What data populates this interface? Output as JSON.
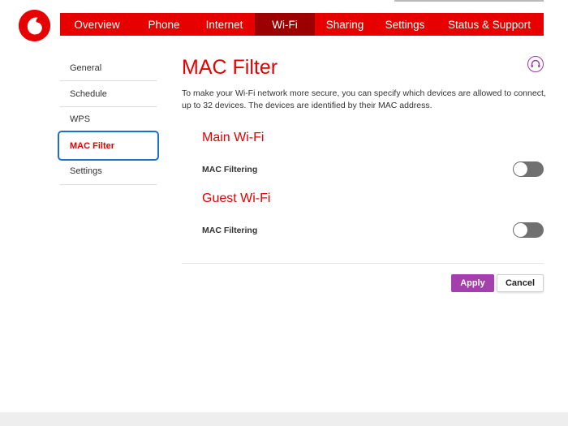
{
  "nav": {
    "tabs": [
      {
        "label": "Overview"
      },
      {
        "label": "Phone"
      },
      {
        "label": "Internet"
      },
      {
        "label": "Wi-Fi"
      },
      {
        "label": "Sharing"
      },
      {
        "label": "Settings"
      },
      {
        "label": "Status & Support"
      }
    ],
    "active": "Wi-Fi"
  },
  "sidebar": {
    "items": [
      {
        "label": "General"
      },
      {
        "label": "Schedule"
      },
      {
        "label": "WPS"
      },
      {
        "label": "MAC Filter"
      },
      {
        "label": "Settings"
      }
    ],
    "active": "MAC Filter"
  },
  "main": {
    "title": "MAC Filter",
    "description": "To make your Wi-Fi network more secure, you can specify which devices are allowed to connect, up to 32 devices. The devices are identified by their MAC address.",
    "sections": [
      {
        "heading": "Main Wi-Fi",
        "label": "MAC Filtering",
        "enabled": false
      },
      {
        "heading": "Guest Wi-Fi",
        "label": "MAC Filtering",
        "enabled": false
      }
    ],
    "apply_label": "Apply",
    "cancel_label": "Cancel"
  },
  "icons": {
    "logo": "vodafone-logo-icon",
    "help": "headset-icon"
  },
  "colors": {
    "brand_red": "#e60000",
    "active_tab": "#9c0000",
    "apply_purple": "#a440ad",
    "focus_blue": "#1c6fd1",
    "toggle_off": "#707070"
  }
}
